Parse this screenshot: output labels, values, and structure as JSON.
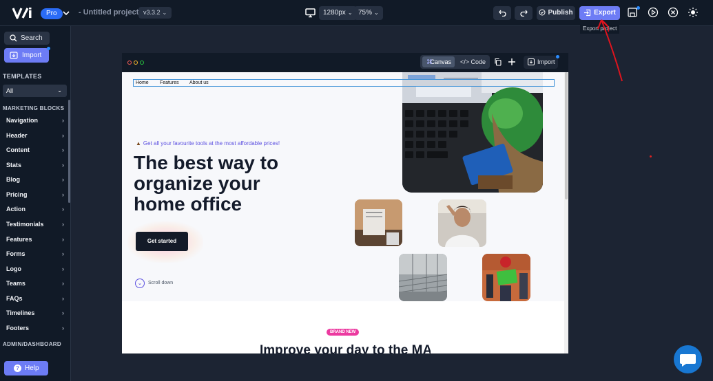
{
  "topbar": {
    "pro_label": "Pro",
    "project_title": "- Untitled project",
    "version": "v3.3.2",
    "width_select": "1280px",
    "zoom_select": "75%",
    "publish_label": "Publish",
    "export_label": "Export",
    "tooltip": "Export project"
  },
  "sidebar": {
    "search_label": "Search",
    "import_label": "Import",
    "templates_heading": "TEMPLATES",
    "template_filter": "All",
    "marketing_heading": "MARKETING BLOCKS",
    "items": [
      {
        "label": "Navigation"
      },
      {
        "label": "Header"
      },
      {
        "label": "Content"
      },
      {
        "label": "Stats"
      },
      {
        "label": "Blog"
      },
      {
        "label": "Pricing"
      },
      {
        "label": "Action"
      },
      {
        "label": "Testimonials"
      },
      {
        "label": "Features"
      },
      {
        "label": "Forms"
      },
      {
        "label": "Logo"
      },
      {
        "label": "Teams"
      },
      {
        "label": "FAQs"
      },
      {
        "label": "Timelines"
      },
      {
        "label": "Footers"
      }
    ],
    "admin_heading": "ADMIN/DASHBOARD",
    "help_label": "Help"
  },
  "frame": {
    "canvas_label": "Canvas",
    "code_label": "Code",
    "import_label": "Import"
  },
  "page": {
    "nav": [
      "Home",
      "Features",
      "About us"
    ],
    "tagline": "Get all your favourite tools at the most affordable prices!",
    "hero_title": "The best way to organize your home office",
    "cta_label": "Get started",
    "scroll_label": "Scroll down",
    "badge": "BRAND NEW",
    "section_title": "Improve your day to the MAX"
  },
  "colors": {
    "accent": "#6d7cf5",
    "pro_badge": "#2b6cf6",
    "background": "#1c2433",
    "panel": "#111a27",
    "badge_pink": "#ec3aa0",
    "annotation_red": "#e0141e"
  }
}
